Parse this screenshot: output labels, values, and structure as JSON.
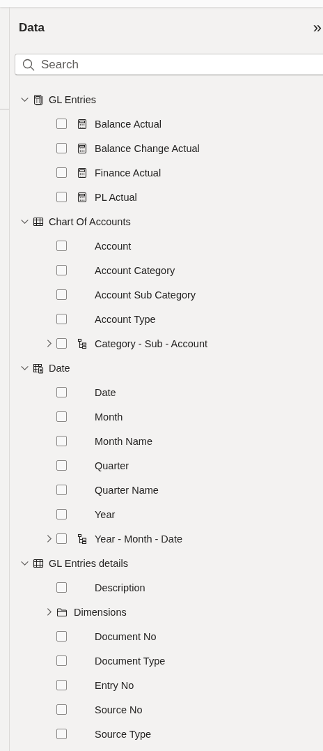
{
  "pane": {
    "title": "Data",
    "collapse_icon": "»"
  },
  "search": {
    "placeholder": "Search"
  },
  "tree": [
    {
      "label": "GL Entries",
      "kind": "measure-table",
      "expanded": true,
      "children": [
        {
          "label": "Balance Actual",
          "kind": "measure",
          "checked": false
        },
        {
          "label": "Balance Change Actual",
          "kind": "measure",
          "checked": false
        },
        {
          "label": "Finance Actual",
          "kind": "measure",
          "checked": false
        },
        {
          "label": "PL Actual",
          "kind": "measure",
          "checked": false
        }
      ]
    },
    {
      "label": "Chart Of Accounts",
      "kind": "table",
      "expanded": true,
      "children": [
        {
          "label": "Account",
          "kind": "column",
          "checked": false
        },
        {
          "label": "Account Category",
          "kind": "column",
          "checked": false
        },
        {
          "label": "Account Sub Category",
          "kind": "column",
          "checked": false
        },
        {
          "label": "Account Type",
          "kind": "column",
          "checked": false
        },
        {
          "label": "Category - Sub - Account",
          "kind": "hierarchy",
          "checked": false,
          "expanded": false
        }
      ]
    },
    {
      "label": "Date",
      "kind": "date-table",
      "expanded": true,
      "children": [
        {
          "label": "Date",
          "kind": "column",
          "checked": false
        },
        {
          "label": "Month",
          "kind": "column",
          "checked": false
        },
        {
          "label": "Month Name",
          "kind": "column",
          "checked": false
        },
        {
          "label": "Quarter",
          "kind": "column",
          "checked": false
        },
        {
          "label": "Quarter Name",
          "kind": "column",
          "checked": false
        },
        {
          "label": "Year",
          "kind": "column",
          "checked": false
        },
        {
          "label": "Year - Month - Date",
          "kind": "hierarchy",
          "checked": false,
          "expanded": false
        }
      ]
    },
    {
      "label": "GL Entries details",
      "kind": "table",
      "expanded": true,
      "children": [
        {
          "label": "Description",
          "kind": "column",
          "checked": false
        },
        {
          "label": "Dimensions",
          "kind": "folder",
          "expanded": false
        },
        {
          "label": "Document No",
          "kind": "column",
          "checked": false
        },
        {
          "label": "Document Type",
          "kind": "column",
          "checked": false
        },
        {
          "label": "Entry No",
          "kind": "column",
          "checked": false
        },
        {
          "label": "Source No",
          "kind": "column",
          "checked": false
        },
        {
          "label": "Source Type",
          "kind": "column",
          "checked": false
        }
      ]
    }
  ]
}
